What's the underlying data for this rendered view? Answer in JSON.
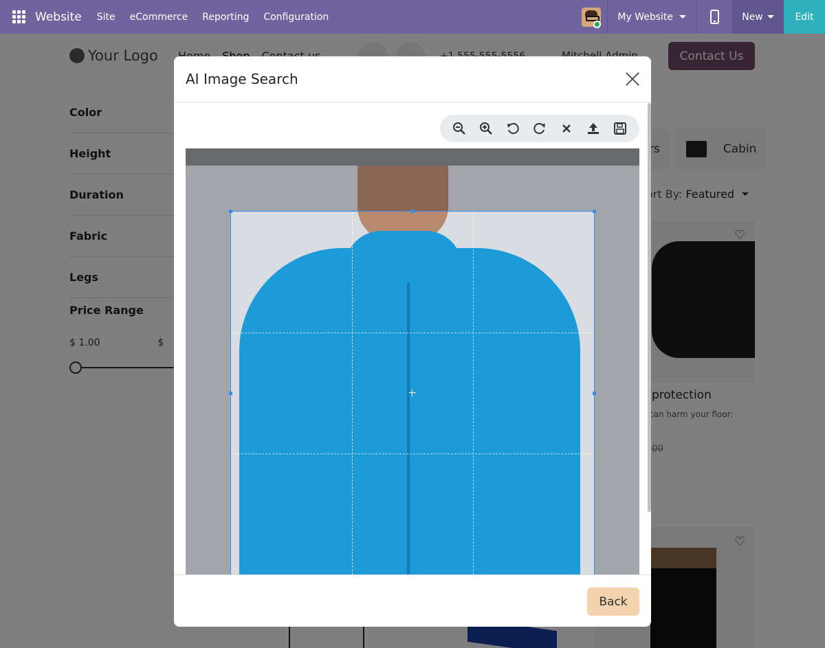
{
  "navbar": {
    "brand": "Website",
    "menu": [
      "Site",
      "eCommerce",
      "Reporting",
      "Configuration"
    ],
    "site_selector": "My Website",
    "new_label": "New",
    "edit_label": "Edit",
    "colors": {
      "bar": "#71639e",
      "new": "#62568e",
      "edit": "#2fb1bd"
    }
  },
  "site": {
    "logo_text": "Your Logo",
    "nav": [
      "Home",
      "Shop",
      "Contact us"
    ],
    "phone": "+1 555-555-5556",
    "user": "Mitchell Admin",
    "contact_button": "Contact Us",
    "filters": [
      "Color",
      "Height",
      "Duration",
      "Fabric",
      "Legs"
    ],
    "price_range_label": "Price Range",
    "price_min": "$ 1.00",
    "price_max": "$",
    "categories": [
      "rs",
      "Cabin"
    ],
    "sort_label": "ort By:",
    "sort_value": "Featured",
    "product_title": "protection",
    "product_desc": "can harm your floor:",
    "product_price": ".00"
  },
  "modal": {
    "title": "AI Image Search",
    "toolbar": [
      "zoom-out",
      "zoom-in",
      "rotate-left",
      "rotate-right",
      "reset",
      "upload",
      "save"
    ],
    "back_label": "Back"
  }
}
